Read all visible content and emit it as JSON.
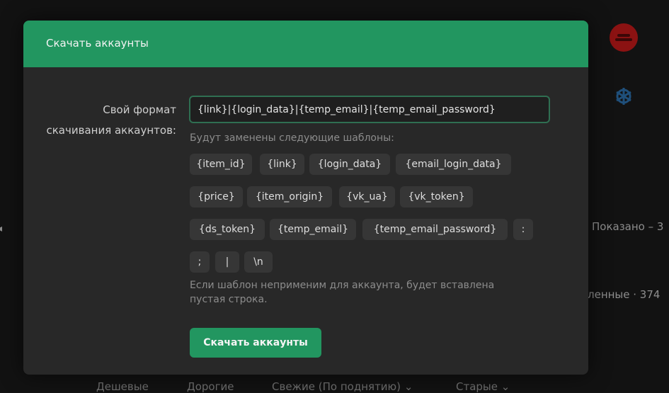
{
  "background": {
    "shown_text": "Показано – 3",
    "changed_text": "ленные · 374",
    "sort_options": [
      "Дешевые",
      "Дорогие",
      "Свежие (По поднятию)",
      "Старые"
    ]
  },
  "modal": {
    "title": "Скачать аккаунты",
    "format_label_line1": "Свой формат",
    "format_label_line2": "скачивания аккаунтов:",
    "format_value": "{link}|{login_data}|{temp_email}|{temp_email_password}",
    "hint": "Будут заменены следующие шаблоны:",
    "templates": [
      "{item_id}",
      "{link}",
      "{login_data}",
      "{email_login_data}",
      "{price}",
      "{item_origin}",
      "{vk_ua}",
      "{vk_token}",
      "{ds_token}",
      "{temp_email}",
      "{temp_email_password}",
      ":",
      ";",
      "|",
      "\\n"
    ],
    "note": "Если шаблон неприменим для аккаунта, будет вставлена пустая строка.",
    "download_label": "Скачать аккаунты"
  },
  "colors": {
    "accent": "#229660",
    "modal_bg": "#282828",
    "chip_bg": "#363636"
  }
}
